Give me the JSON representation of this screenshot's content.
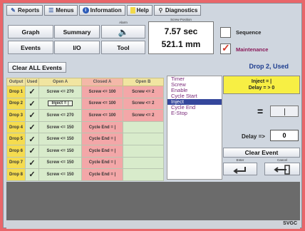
{
  "menu": [
    {
      "label": "Reports",
      "icon": "reports-icon",
      "glyph": "✎"
    },
    {
      "label": "Menus",
      "icon": "menus-icon",
      "glyph": "☰"
    },
    {
      "label": "Information",
      "icon": "info-icon",
      "glyph": "ℹ"
    },
    {
      "label": "Help",
      "icon": "help-icon",
      "glyph": ""
    },
    {
      "label": "Diagnostics",
      "icon": "diagnostics-icon",
      "glyph": "⚲"
    }
  ],
  "buttons": {
    "graph": "Graph",
    "summary": "Summary",
    "events": "Events",
    "io": "I/O",
    "tool": "Tool",
    "clear_all_events": "Clear ALL Events",
    "clear_event": "Clear Event"
  },
  "alarm_label": "Alarm",
  "screw_position_label": "Screw Position",
  "readout": {
    "time": "7.57 sec",
    "distance": "521.1 mm"
  },
  "checkboxes": {
    "sequence": "Sequence",
    "maintenance": "Maintenance",
    "maintenance_checked": true
  },
  "table": {
    "headers": [
      "Output",
      "Used",
      "Open A",
      "Closed A",
      "Open B"
    ],
    "rows": [
      {
        "output": "Drop 1",
        "used": "✓",
        "openA": "Screw <= 270",
        "closedA": "Screw <= 100",
        "openB": "Screw <= 2"
      },
      {
        "output": "Drop 2",
        "used": "✓",
        "openA": "Inject = |",
        "closedA": "Screw <= 100",
        "openB": "Screw <= 2"
      },
      {
        "output": "Drop 3",
        "used": "✓",
        "openA": "Screw <= 270",
        "closedA": "Screw <= 100",
        "openB": "Screw <= 2"
      },
      {
        "output": "Drop 4",
        "used": "✓",
        "openA": "Screw <= 150",
        "closedA": "Cycle End = |",
        "openB": ""
      },
      {
        "output": "Drop 5",
        "used": "✓",
        "openA": "Screw <= 150",
        "closedA": "Cycle End = |",
        "openB": ""
      },
      {
        "output": "Drop 6",
        "used": "✓",
        "openA": "Screw <= 150",
        "closedA": "Cycle End = |",
        "openB": ""
      },
      {
        "output": "Drop 7",
        "used": "✓",
        "openA": "Screw <= 150",
        "closedA": "Cycle End = |",
        "openB": ""
      },
      {
        "output": "Drop 8",
        "used": "✓",
        "openA": "Screw <= 150",
        "closedA": "Cycle End = |",
        "openB": ""
      }
    ]
  },
  "panel_title": "Drop 2, Used",
  "event_list": [
    "Timer",
    "Screw",
    "Enable",
    "Cycle Start",
    "Inject",
    "Cycle End",
    "E-Stop"
  ],
  "event_selected": "Inject",
  "condition": {
    "line1": "Inject = |",
    "line2": "Delay = > 0"
  },
  "delay": {
    "label": "Delay =>",
    "value": "0"
  },
  "enter_label": "Enter",
  "cancel_label": "Cancel",
  "status": {
    "brand": "SVGC"
  },
  "colors": {
    "frame": "#e9666a",
    "selected": "#35479c",
    "yellow": "#f7ef44",
    "green_cell": "#d8ebcb",
    "red_cell": "#f3a7a8"
  }
}
